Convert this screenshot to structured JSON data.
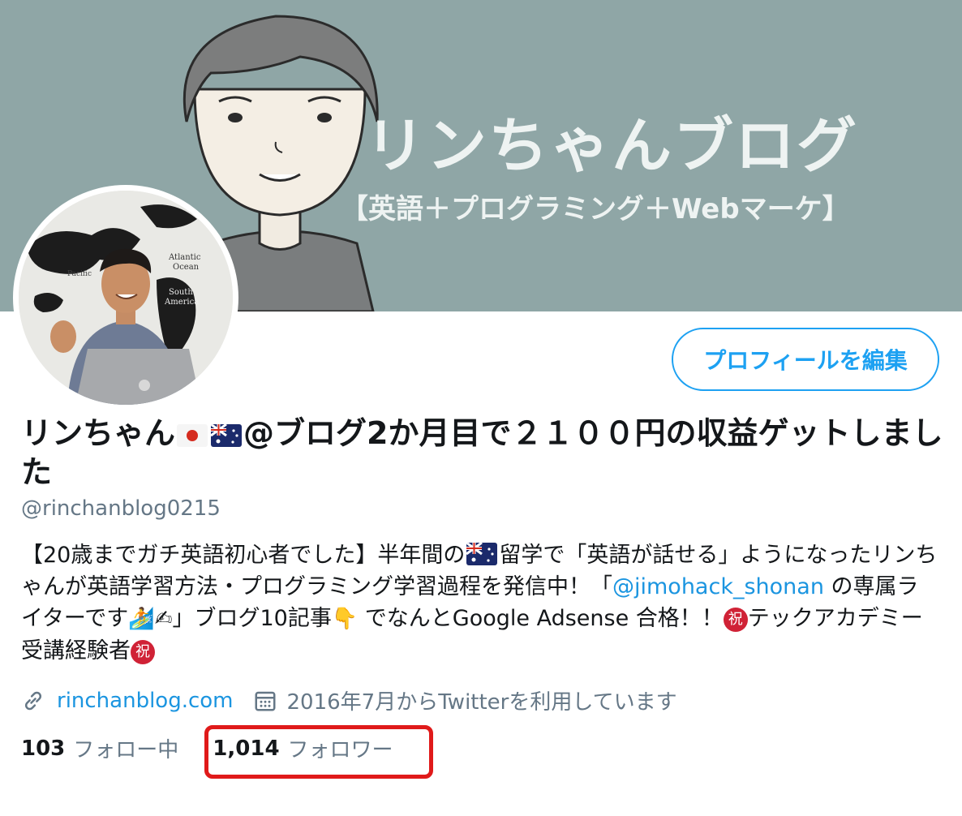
{
  "banner": {
    "title": "リンちゃんブログ",
    "subtitle": "【英語＋プログラミング＋Webマーケ】"
  },
  "avatar": {
    "map_labels": [
      "Atlantic Ocean",
      "South America",
      "Pacific"
    ]
  },
  "edit_profile_label": "プロフィールを編集",
  "profile": {
    "name_prefix": "リンちゃん",
    "name_suffix": "@ブログ2か月目で２１００円の収益ゲットしました",
    "handle": "@rinchanblog0215",
    "bio": {
      "p1": "【20歳までガチ英語初心者でした】半年間の",
      "p2": "留学で「英語が話せる」ようになったリンちゃんが英語学習方法・プログラミング学習過程を発信中！「",
      "mention": "@jimohack_shonan",
      "p3": " の専属ライターです",
      "p4": "」ブログ10記事",
      "p5": " でなんとGoogle Adsense 合格！！",
      "p6": "テックアカデミー受講経験者",
      "iwai": "祝"
    },
    "website": "rinchanblog.com",
    "joined": "2016年7月からTwitterを利用しています"
  },
  "stats": {
    "following_count": "103",
    "following_label": "フォロー中",
    "followers_count": "1,014",
    "followers_label": "フォロワー"
  },
  "colors": {
    "accent": "#1da1f2",
    "link": "#1b95e0",
    "banner": "#8fa6a6",
    "highlight": "#e01a1a"
  },
  "icons": [
    "link-icon",
    "calendar-icon",
    "japan-flag-icon",
    "australia-flag-icon",
    "surfer-emoji",
    "writing-hand-emoji",
    "pointing-down-emoji",
    "congratulations-icon"
  ]
}
